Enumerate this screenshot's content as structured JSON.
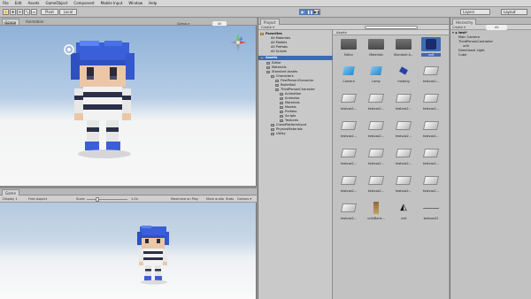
{
  "menu": [
    "File",
    "Edit",
    "Assets",
    "GameObject",
    "Component",
    "Mobile Input",
    "Window",
    "Help"
  ],
  "toolbar": {
    "tools": [
      "✋",
      "✥",
      "⟳",
      "⤡",
      "▭"
    ],
    "pivot": "Pivot",
    "local": "Local",
    "play": "▶",
    "pause": "❚❚",
    "step": "▶❚",
    "layers": "Layers",
    "layout": "Layout"
  },
  "scene": {
    "tabs": [
      "Scene",
      "Animation"
    ],
    "shading": "Textured",
    "gizmos": "Gizmos ▾",
    "search": "All"
  },
  "game": {
    "tab": "Game",
    "display": "Display 1",
    "aspect": "Free Aspect",
    "scale_label": "Scale",
    "scale_value": "1.0x",
    "maximize": "Maximize on Play",
    "mute": "Mute audio",
    "stats": "Stats",
    "gizmos": "Gizmos ▾"
  },
  "project": {
    "tab": "Project",
    "create": "Create ▾",
    "favorites_title": "Favorites",
    "favorites": [
      "All Materials",
      "All Models",
      "All Prefabs",
      "All Scripts"
    ],
    "assets_title": "Assets",
    "tree": [
      {
        "label": "Editor",
        "indent": 1
      },
      {
        "label": "Materials",
        "indent": 1
      },
      {
        "label": "Standard Assets",
        "indent": 1
      },
      {
        "label": "Characters",
        "indent": 2
      },
      {
        "label": "FirstPersonCharacter",
        "indent": 3
      },
      {
        "label": "RollerBall",
        "indent": 3
      },
      {
        "label": "ThirdPersonCharacter",
        "indent": 3
      },
      {
        "label": "Animation",
        "indent": 4
      },
      {
        "label": "Animator",
        "indent": 4
      },
      {
        "label": "Materials",
        "indent": 4
      },
      {
        "label": "Models",
        "indent": 4
      },
      {
        "label": "Prefabs",
        "indent": 4
      },
      {
        "label": "Scripts",
        "indent": 4
      },
      {
        "label": "Textures",
        "indent": 4
      },
      {
        "label": "CrossPlatformInput",
        "indent": 2
      },
      {
        "label": "PhysicsMaterials",
        "indent": 2
      },
      {
        "label": "Utility",
        "indent": 2
      }
    ],
    "breadcrumb": "Assets",
    "assets": [
      [
        "Editor",
        "Materials",
        "Standard A...",
        "unit"
      ],
      [
        "Camera",
        "Lamp",
        "metarig",
        "testvox2..."
      ],
      [
        "testvox2...",
        "testvox2...",
        "testvox2...",
        "testvox2..."
      ],
      [
        "testvox2...",
        "testvox2...",
        "testvox2...",
        "testvox2..."
      ],
      [
        "testvox2...",
        "testvox2...",
        "testvox2...",
        "testvox2..."
      ],
      [
        "testvox2...",
        "testvox2...",
        "testvox2...",
        "testvox2..."
      ],
      [
        "testvox2...",
        "unit/Bone...",
        "unit",
        "testvox22"
      ]
    ]
  },
  "hierarchy": {
    "tab": "Hierarchy",
    "create": "Create ▾",
    "search": "All",
    "scene": "test*",
    "items": [
      {
        "label": "Main Camera",
        "indent": 1
      },
      {
        "label": "ThirdPersonController",
        "indent": 1
      },
      {
        "label": "unit",
        "indent": 2
      },
      {
        "label": "Directional Light",
        "indent": 1
      },
      {
        "label": "Cube",
        "indent": 1
      }
    ]
  },
  "colors": {
    "accent": "#3e6bb0",
    "voxel_blue": "#3a5fd8",
    "voxel_hair_light": "#5d82f2"
  }
}
